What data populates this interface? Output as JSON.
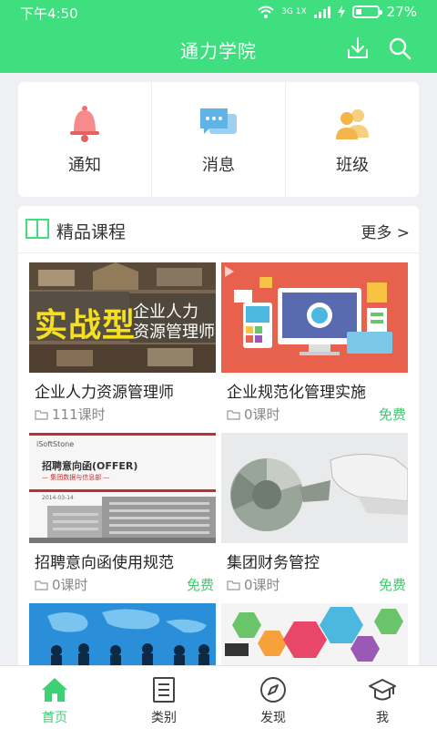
{
  "status_bar": {
    "time": "下午4:50",
    "signal": "3G 1X",
    "battery": "27%",
    "battery_level": 0.27
  },
  "header": {
    "title": "通力学院"
  },
  "quick_actions": [
    {
      "label": "通知",
      "icon": "bell-icon"
    },
    {
      "label": "消息",
      "icon": "chat-icon"
    },
    {
      "label": "班级",
      "icon": "people-icon"
    }
  ],
  "section": {
    "title": "精品课程",
    "more": "更多 >",
    "courses": [
      {
        "title": "企业人力资源管理师",
        "lessons": "111课时",
        "free": "",
        "thumb_text": {
          "main": "实战型",
          "line1": "企业人力",
          "line2": "资源管理师"
        }
      },
      {
        "title": "企业规范化管理实施",
        "lessons": "0课时",
        "free": "免费"
      },
      {
        "title": "招聘意向函使用规范",
        "lessons": "0课时",
        "free": "免费",
        "thumb_text": {
          "brand": "iSoftStone",
          "main": "招聘意向函(OFFER)",
          "sub": "— 集团数据与信息部 —",
          "date": "2014-03-14"
        }
      },
      {
        "title": "集团财务管控",
        "lessons": "0课时",
        "free": "免费"
      },
      {
        "title": "",
        "lessons": "",
        "free": ""
      },
      {
        "title": "",
        "lessons": "",
        "free": ""
      }
    ]
  },
  "bottom_nav": [
    {
      "label": "首页",
      "icon": "home-icon",
      "active": true
    },
    {
      "label": "类别",
      "icon": "list-icon",
      "active": false
    },
    {
      "label": "发现",
      "icon": "compass-icon",
      "active": false
    },
    {
      "label": "我",
      "icon": "graduation-cap-icon",
      "active": false
    }
  ],
  "colors": {
    "primary": "#3fdf7f",
    "free": "#3fc96f",
    "background": "#eef0f4"
  }
}
